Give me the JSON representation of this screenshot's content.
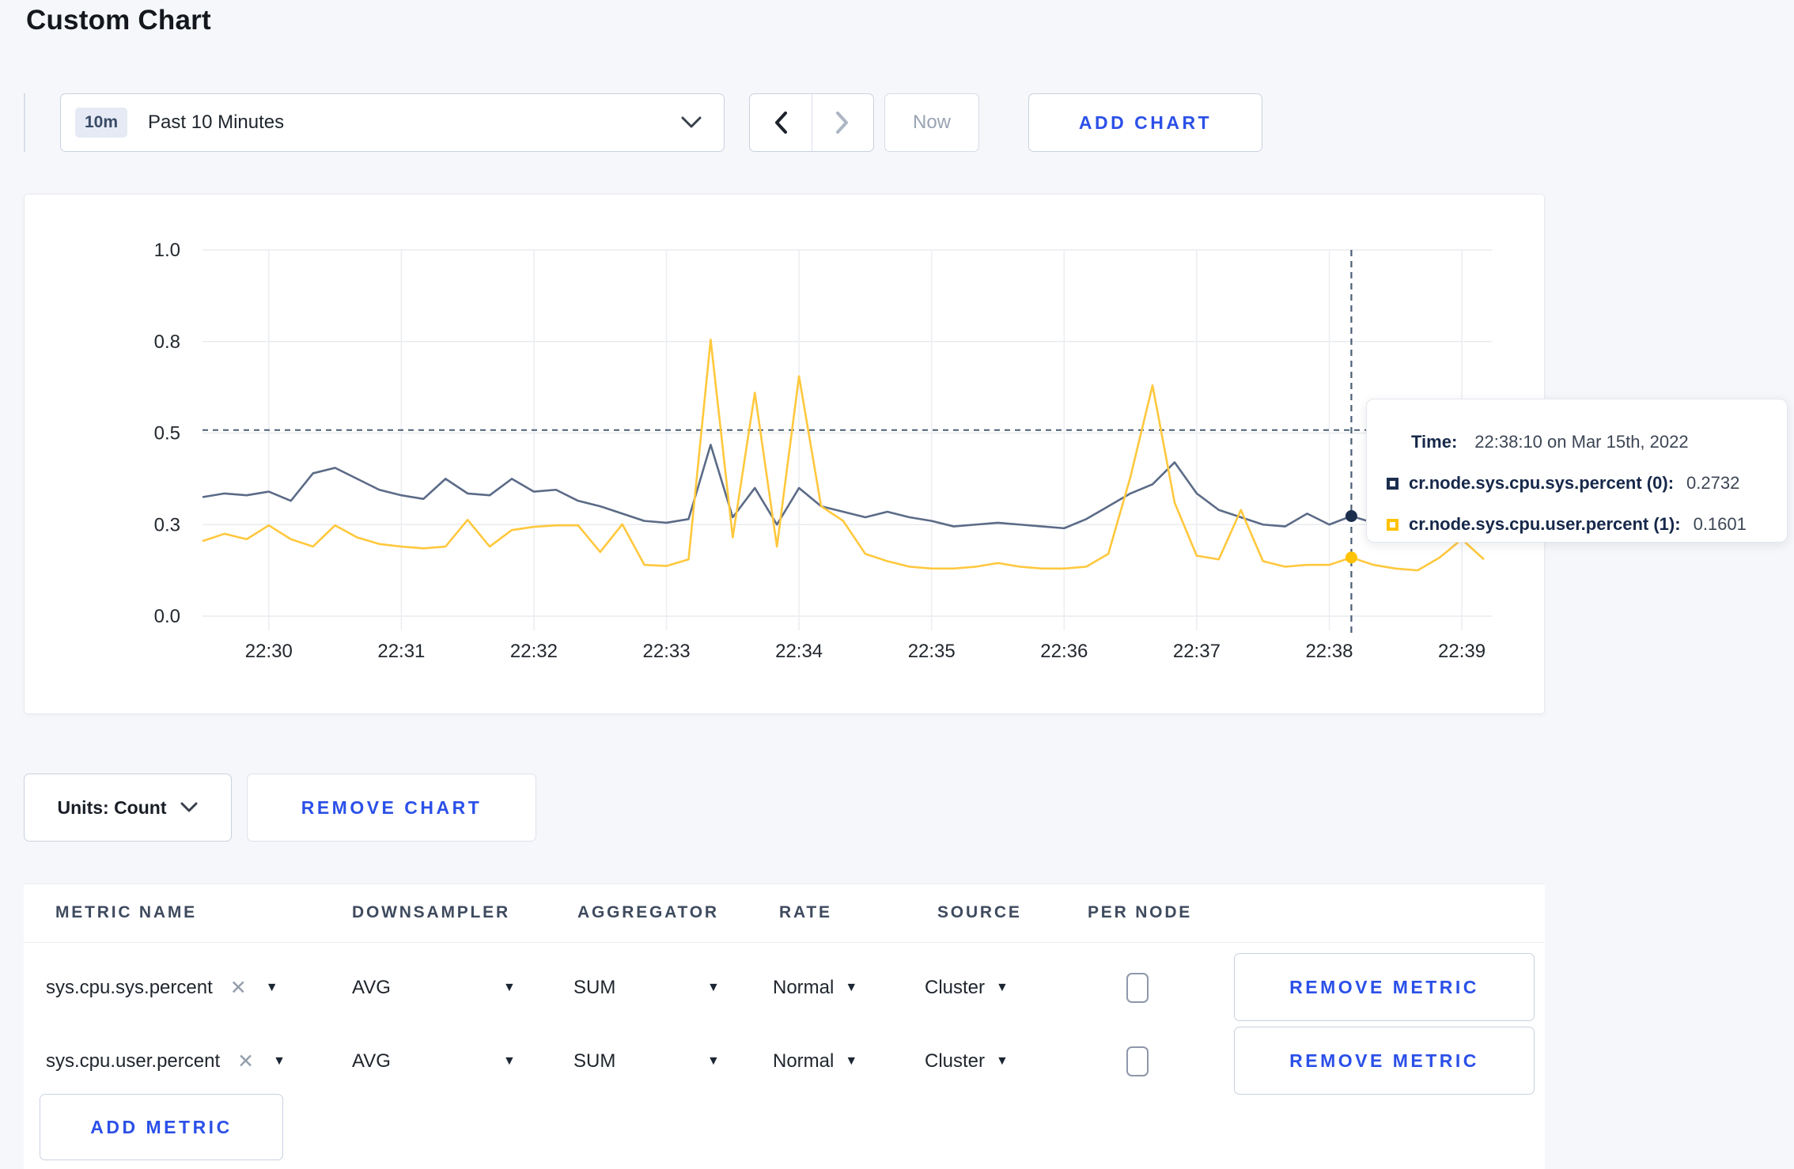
{
  "page_title": "Custom Chart",
  "toolbar": {
    "time_badge": "10m",
    "time_label": "Past 10 Minutes",
    "now_label": "Now",
    "add_chart_label": "ADD CHART"
  },
  "chart_controls": {
    "units_label": "Units: Count",
    "remove_chart_label": "REMOVE CHART"
  },
  "tooltip": {
    "time_label": "Time:",
    "time_value": "22:38:10 on Mar 15th, 2022",
    "series": [
      {
        "name": "cr.node.sys.cpu.sys.percent (0):",
        "value": "0.2732",
        "color": "#1b2e4d"
      },
      {
        "name": "cr.node.sys.cpu.user.percent (1):",
        "value": "0.1601",
        "color": "#ffc200"
      }
    ]
  },
  "chart_data": {
    "type": "line",
    "title": "",
    "xlabel": "",
    "ylabel": "",
    "ylim": [
      0,
      1
    ],
    "grid": true,
    "legend_position": "none",
    "x_start": "22:29:30",
    "x_step_seconds": 10,
    "y_ticks": [
      {
        "label": "0.0",
        "value": 0
      },
      {
        "label": "0.3",
        "value": 0.25
      },
      {
        "label": "0.5",
        "value": 0.5
      },
      {
        "label": "0.8",
        "value": 0.75
      },
      {
        "label": "1.0",
        "value": 1.0
      }
    ],
    "x_ticks": [
      {
        "label": "22:30",
        "index": 3
      },
      {
        "label": "22:31",
        "index": 9
      },
      {
        "label": "22:32",
        "index": 15
      },
      {
        "label": "22:33",
        "index": 21
      },
      {
        "label": "22:34",
        "index": 27
      },
      {
        "label": "22:35",
        "index": 33
      },
      {
        "label": "22:36",
        "index": 39
      },
      {
        "label": "22:37",
        "index": 45
      },
      {
        "label": "22:38",
        "index": 51
      },
      {
        "label": "22:39",
        "index": 57
      }
    ],
    "series": [
      {
        "name": "cr.node.sys.cpu.sys.percent",
        "color": "#5b6b87",
        "values": [
          0.325,
          0.335,
          0.33,
          0.34,
          0.315,
          0.39,
          0.405,
          0.375,
          0.345,
          0.33,
          0.32,
          0.375,
          0.335,
          0.33,
          0.375,
          0.34,
          0.345,
          0.315,
          0.3,
          0.28,
          0.26,
          0.255,
          0.265,
          0.468,
          0.27,
          0.35,
          0.25,
          0.35,
          0.3,
          0.285,
          0.27,
          0.285,
          0.27,
          0.26,
          0.245,
          0.25,
          0.255,
          0.25,
          0.245,
          0.24,
          0.265,
          0.3,
          0.335,
          0.36,
          0.42,
          0.335,
          0.29,
          0.27,
          0.25,
          0.245,
          0.28,
          0.25,
          0.2732,
          0.255,
          0.25,
          0.27,
          0.29,
          0.285,
          0.295
        ]
      },
      {
        "name": "cr.node.sys.cpu.user.percent",
        "color": "#ffc83d",
        "values": [
          0.205,
          0.225,
          0.21,
          0.248,
          0.21,
          0.19,
          0.248,
          0.215,
          0.197,
          0.19,
          0.185,
          0.19,
          0.263,
          0.19,
          0.235,
          0.244,
          0.248,
          0.248,
          0.175,
          0.251,
          0.14,
          0.137,
          0.155,
          0.755,
          0.215,
          0.61,
          0.19,
          0.655,
          0.3,
          0.26,
          0.17,
          0.15,
          0.135,
          0.13,
          0.13,
          0.135,
          0.145,
          0.135,
          0.13,
          0.13,
          0.135,
          0.17,
          0.38,
          0.63,
          0.31,
          0.165,
          0.155,
          0.29,
          0.15,
          0.135,
          0.14,
          0.14,
          0.1601,
          0.14,
          0.13,
          0.125,
          0.16,
          0.21,
          0.155
        ]
      }
    ],
    "crosshair": {
      "index": 52,
      "hline_value": 0.508,
      "color": "#4a5f76"
    }
  },
  "metrics": {
    "headers": [
      "METRIC NAME",
      "DOWNSAMPLER",
      "AGGREGATOR",
      "RATE",
      "SOURCE",
      "PER NODE"
    ],
    "remove_metric_label": "REMOVE METRIC",
    "add_metric_label": "ADD METRIC",
    "rows": [
      {
        "metric": "sys.cpu.sys.percent",
        "downsampler": "AVG",
        "aggregator": "SUM",
        "rate": "Normal",
        "source": "Cluster",
        "per_node_checked": false
      },
      {
        "metric": "sys.cpu.user.percent",
        "downsampler": "AVG",
        "aggregator": "SUM",
        "rate": "Normal",
        "source": "Cluster",
        "per_node_checked": false
      }
    ]
  }
}
